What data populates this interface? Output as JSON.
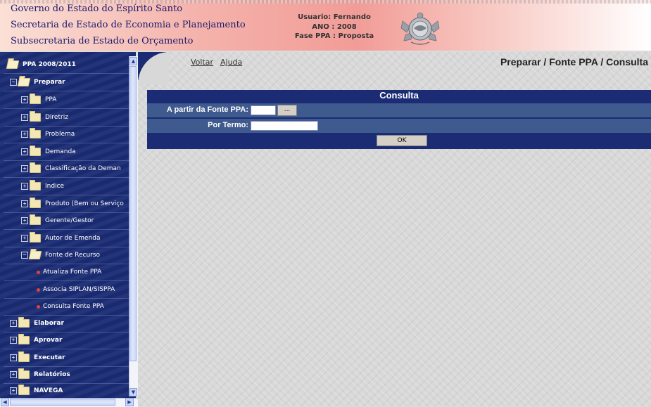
{
  "header": {
    "org_lines": [
      "Governo do Estado do Espírito Santo",
      "Secretaria de Estado de Economia e Planejamento",
      "Subsecretaria de Estado de Orçamento"
    ],
    "user": "Usuario: Fernando",
    "year": "ANO : 2008",
    "phase": "Fase PPA : Proposta",
    "crest_icon": "state-coat-of-arms"
  },
  "sidebar": {
    "root": "PPA 2008/2011",
    "items": [
      {
        "label": "Preparar"
      },
      {
        "label": "PPA"
      },
      {
        "label": "Diretriz"
      },
      {
        "label": "Problema"
      },
      {
        "label": "Demanda"
      },
      {
        "label": "Classificação da Deman"
      },
      {
        "label": "Indice"
      },
      {
        "label": "Produto (Bem ou Serviço"
      },
      {
        "label": "Gerente/Gestor"
      },
      {
        "label": "Autor de Emenda"
      },
      {
        "label": "Fonte de Recurso"
      },
      {
        "label": "Atualiza Fonte PPA"
      },
      {
        "label": "Associa SIPLAN/SISPPA"
      },
      {
        "label": "Consulta Fonte PPA"
      },
      {
        "label": "Elaborar"
      },
      {
        "label": "Aprovar"
      },
      {
        "label": "Executar"
      },
      {
        "label": "Relatórios"
      },
      {
        "label": "NAVEGA"
      }
    ],
    "colors": {
      "background": "#1b2c74",
      "leaf_bullet": "#e04040"
    }
  },
  "main": {
    "links": {
      "back": "Voltar",
      "help": "Ajuda"
    },
    "page_title": "Preparar / Fonte PPA / Consulta",
    "form": {
      "title": "Consulta",
      "fields": [
        {
          "label": "A partir da Fonte PPA:",
          "value": "",
          "button": "..."
        },
        {
          "label": "Por Termo:",
          "value": ""
        }
      ],
      "ok": "OK"
    }
  }
}
